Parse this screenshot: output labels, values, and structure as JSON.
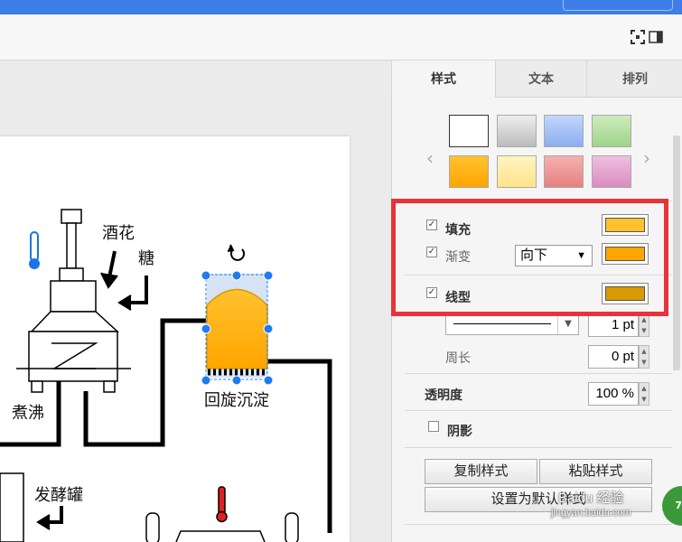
{
  "diagram": {
    "labels": {
      "hops": "酒花",
      "sugar": "糖",
      "boil": "煮沸",
      "whirlpool": "回旋沉淀",
      "fermenter": "发酵罐"
    }
  },
  "panel": {
    "tabs": [
      "样式",
      "文本",
      "排列"
    ],
    "active_tab": "样式",
    "swatches": [
      "#ffffff",
      "#cfcfcf",
      "#a9c4f5",
      "#b7e1a1",
      "#ffb300",
      "#fff2b0",
      "#f19c9c",
      "#e7a8d4"
    ],
    "fill": {
      "label": "填充",
      "checked": true,
      "color": "#ffc22e"
    },
    "gradient": {
      "label": "渐变",
      "checked": true,
      "direction": "向下",
      "color": "#ffa500"
    },
    "line": {
      "label": "线型",
      "checked": true,
      "color": "#d99a00"
    },
    "line_width": "1 pt",
    "perimeter": {
      "label": "周长",
      "value": "0 pt"
    },
    "opacity": {
      "label": "透明度",
      "value": "100 %"
    },
    "shadow": {
      "label": "阴影",
      "checked": false
    },
    "buttons": {
      "copy_style": "复制样式",
      "paste_style": "粘贴样式",
      "set_default": "设置为默认样式"
    }
  },
  "watermark": {
    "text": "Baidu 经验",
    "url": "jingyan.baidu.com",
    "badge": "70"
  },
  "colors": {
    "accent": "#3d7ee8",
    "highlight": "#e8333a",
    "selection": "#1e7cf0"
  }
}
